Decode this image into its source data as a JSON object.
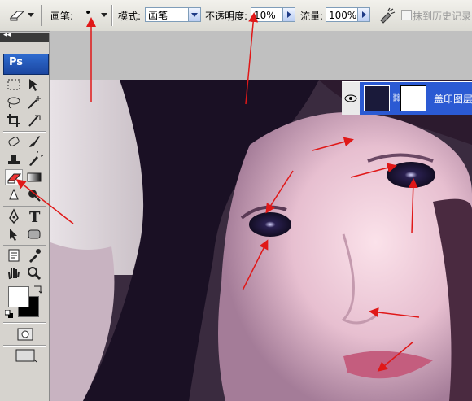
{
  "options_bar": {
    "brush_label": "画笔:",
    "brush_size": "•",
    "mode_label": "模式:",
    "mode_value": "画笔",
    "opacity_label": "不透明度:",
    "opacity_value": "10%",
    "flow_label": "流量:",
    "flow_value": "100%",
    "erase_history_label": "抹到历史记录"
  },
  "toolbox": {
    "collapse_label": "◂◂",
    "logo": "Ps"
  },
  "layers": {
    "active_layer_name": "盖印图层"
  },
  "colors": {
    "annotation_arrows": "#e01818",
    "layer_selected": "#2b5ad3",
    "toolbox_bg": "#d6d3ce"
  }
}
